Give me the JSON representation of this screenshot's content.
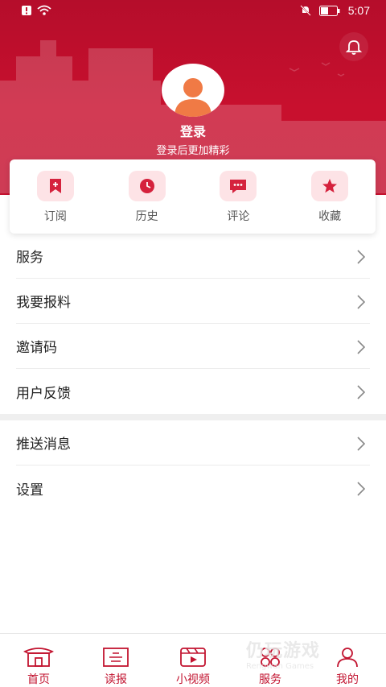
{
  "status_bar": {
    "time": "5:07"
  },
  "profile": {
    "login_title": "登录",
    "login_subtitle": "登录后更加精彩"
  },
  "quick_actions": [
    {
      "label": "订阅",
      "icon": "bookmark-plus-icon"
    },
    {
      "label": "历史",
      "icon": "clock-icon"
    },
    {
      "label": "评论",
      "icon": "chat-bubble-icon"
    },
    {
      "label": "收藏",
      "icon": "star-icon"
    }
  ],
  "menu": [
    {
      "label": "服务"
    },
    {
      "label": "我要报料"
    },
    {
      "label": "邀请码"
    },
    {
      "label": "用户反馈"
    }
  ],
  "menu2": [
    {
      "label": "推送消息"
    },
    {
      "label": "设置"
    }
  ],
  "tabs": [
    {
      "label": "首页",
      "icon": "home-icon"
    },
    {
      "label": "读报",
      "icon": "newspaper-icon"
    },
    {
      "label": "小视频",
      "icon": "video-icon"
    },
    {
      "label": "服务",
      "icon": "services-icon"
    },
    {
      "label": "我的",
      "icon": "user-icon"
    }
  ],
  "watermark": {
    "title": "仍玩游戏",
    "subtitle": "Rengwan Games"
  },
  "colors": {
    "brand": "#c8102e",
    "icon_bg": "#fde3e6"
  }
}
